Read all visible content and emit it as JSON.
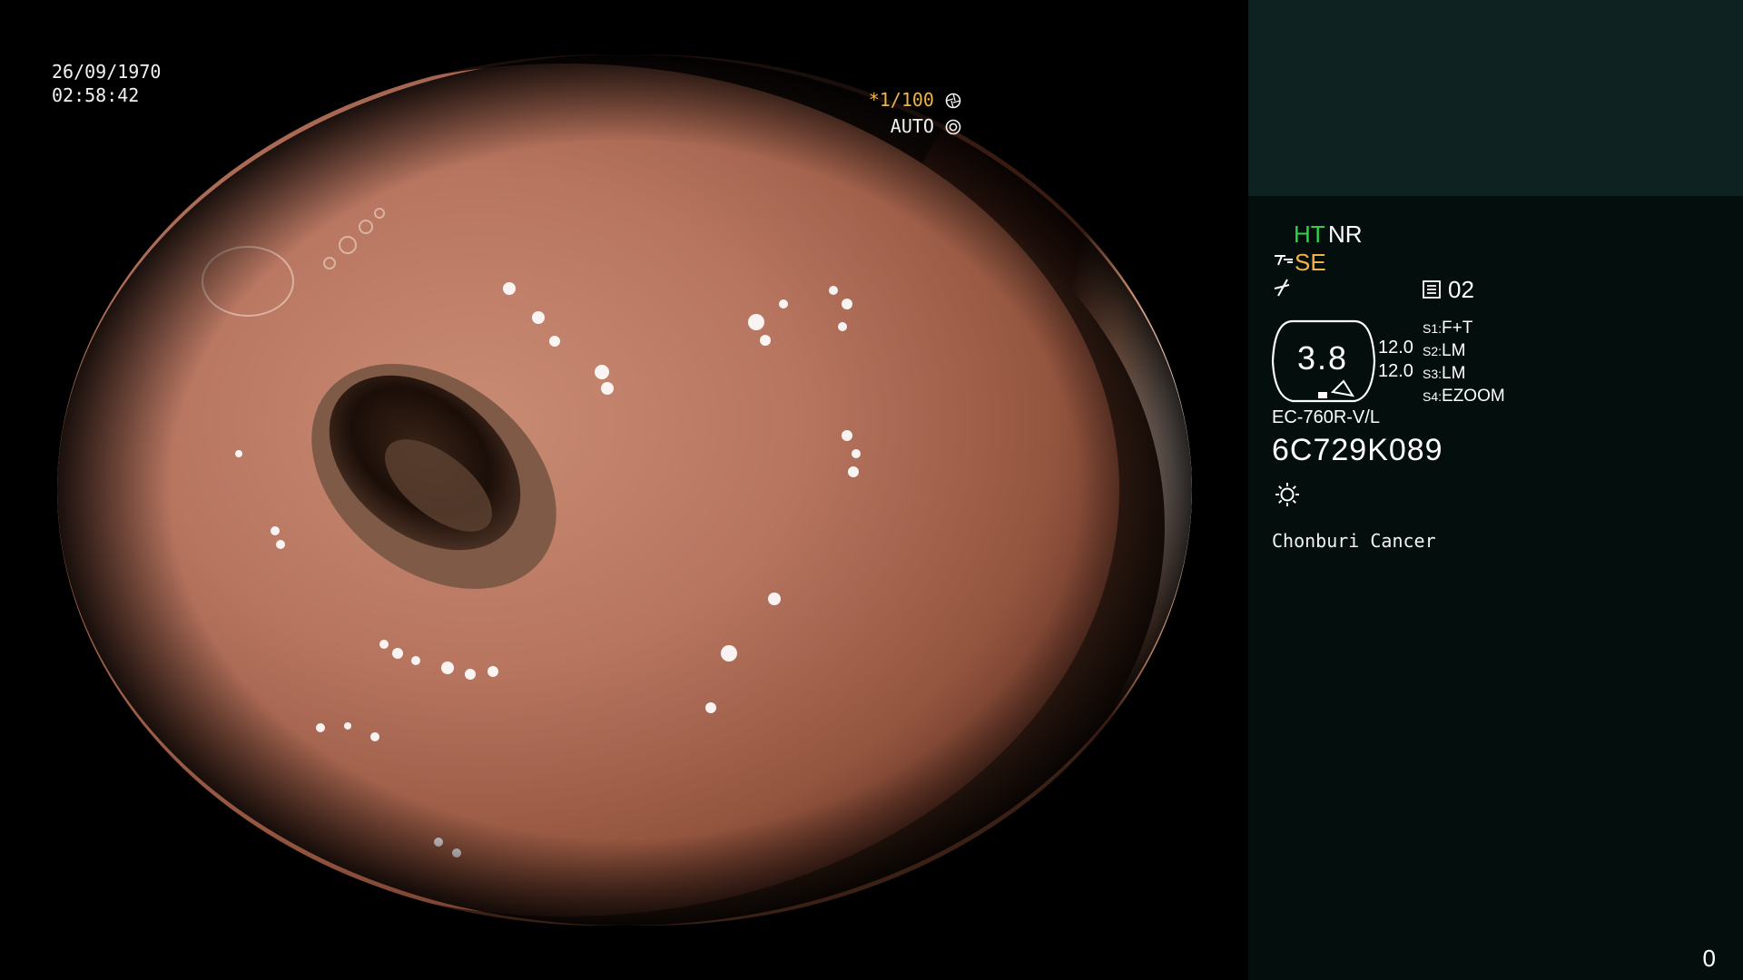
{
  "overlay": {
    "date": "26/09/1970",
    "time": "02:58:42",
    "shutter": "*1/100",
    "iris_mode": "AUTO"
  },
  "panel": {
    "ht": "HT",
    "nr": "NR",
    "se": "SE",
    "memo_number": "02",
    "zoom_value": "3.8",
    "value_1": "12.0",
    "value_2": "12.0",
    "slots": [
      {
        "key": "S1:",
        "value": "F+T"
      },
      {
        "key": "S2:",
        "value": "LM"
      },
      {
        "key": "S3:",
        "value": "LM"
      },
      {
        "key": "S4:",
        "value": "EZOOM"
      }
    ],
    "scope_model": "EC-760R-V/L",
    "scope_serial": "6C729K089",
    "institution": "Chonburi Cancer",
    "counter": "0"
  },
  "icons": {
    "shutter": "aperture-icon",
    "iris": "iris-icon",
    "se": "brush-icon",
    "wave": "wave-icon",
    "memo": "memo-icon",
    "light": "light-icon"
  },
  "colors": {
    "accent_orange": "#f0b347",
    "accent_green": "#31d247",
    "panel_bg": "#040f0d",
    "panel_top_bg": "#0d2221"
  }
}
